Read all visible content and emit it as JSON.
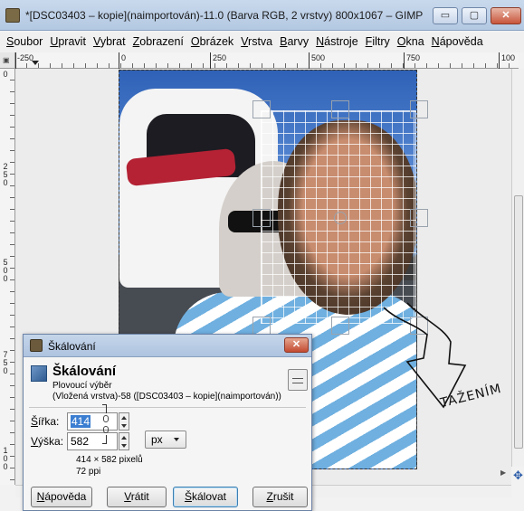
{
  "window": {
    "title": "*[DSC03403 – kopie](naimportován)-11.0 (Barva RGB, 2 vrstvy) 800x1067 – GIMP",
    "minimize": "▭",
    "maximize": "▢",
    "close": "✕"
  },
  "menu": [
    "Soubor",
    "Upravit",
    "Vybrat",
    "Zobrazení",
    "Obrázek",
    "Vrstva",
    "Barvy",
    "Nástroje",
    "Filtry",
    "Okna",
    "Nápověda"
  ],
  "ruler": {
    "corner": "▣",
    "h_ticks": [
      "-250",
      "0",
      "250",
      "500",
      "750",
      "100"
    ],
    "v_ticks": [
      "0",
      "2 5 0",
      "5 0 0",
      "7 5 0",
      "1 0 0"
    ]
  },
  "annotation": {
    "text": "TAŽENÍM",
    "color": "#111111"
  },
  "dialog": {
    "window_title": "Škálování",
    "close": "✕",
    "header_title": "Škálování",
    "header_subtitle": "Plovoucí výběr",
    "header_detail": "(Vložená vrstva)-58 ([DSC03403 – kopie](naimportován))",
    "width_label": "Šířka:",
    "width_value": "414",
    "height_label": "Výška:",
    "height_value": "582",
    "unit": "px",
    "info_size": "414 × 582 pixelů",
    "info_res": "72 ppi",
    "buttons": {
      "help": "Nápověda",
      "reset": "Vrátit",
      "scale": "Škálovat",
      "cancel": "Zrušit"
    }
  },
  "colors": {
    "titlebar": "#b3c8e2",
    "selection_highlight": "#3b7ed1",
    "close_button": "#c8553b"
  },
  "icons": {
    "app": "gimp-icon",
    "nav": "navigate-icon",
    "chain": "chain-link-icon"
  }
}
